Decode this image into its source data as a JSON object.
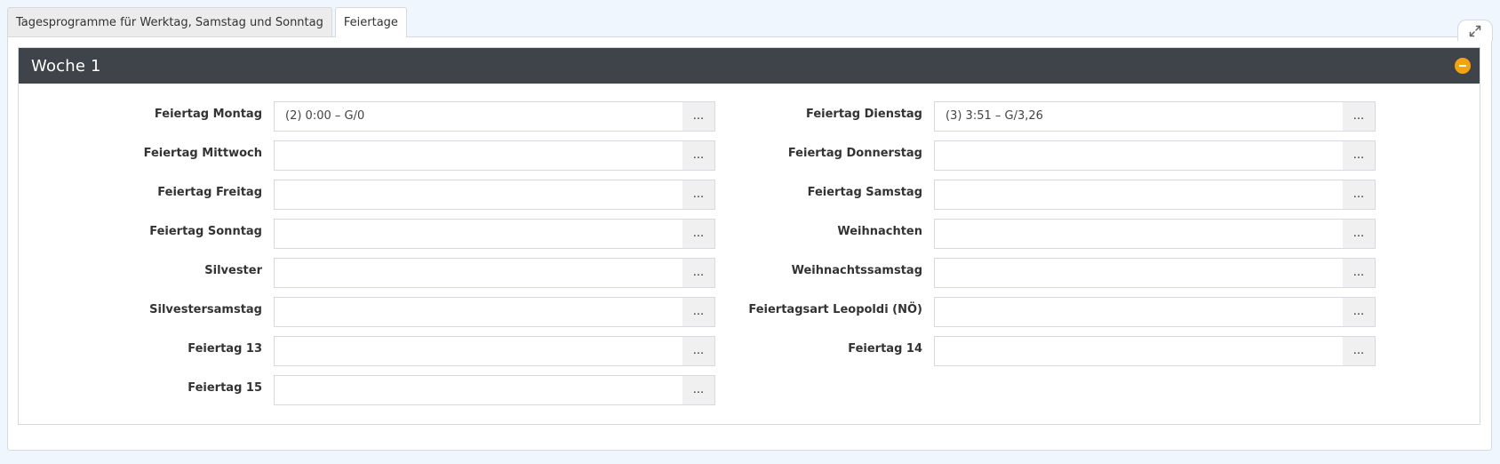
{
  "tabs": [
    {
      "label": "Tagesprogramme für Werktag, Samstag und Sonntag",
      "active": false
    },
    {
      "label": "Feiertage",
      "active": true
    }
  ],
  "section": {
    "title": "Woche 1"
  },
  "picker_label": "...",
  "left_fields": [
    {
      "label": "Feiertag Montag",
      "value": "(2) 0:00 – G/0"
    },
    {
      "label": "Feiertag Mittwoch",
      "value": ""
    },
    {
      "label": "Feiertag Freitag",
      "value": ""
    },
    {
      "label": "Feiertag Sonntag",
      "value": ""
    },
    {
      "label": "Silvester",
      "value": ""
    },
    {
      "label": "Silvestersamstag",
      "value": ""
    },
    {
      "label": "Feiertag 13",
      "value": ""
    },
    {
      "label": "Feiertag 15",
      "value": ""
    }
  ],
  "right_fields": [
    {
      "label": "Feiertag Dienstag",
      "value": "(3) 3:51 – G/3,26"
    },
    {
      "label": "Feiertag Donnerstag",
      "value": ""
    },
    {
      "label": "Feiertag Samstag",
      "value": ""
    },
    {
      "label": "Weihnachten",
      "value": ""
    },
    {
      "label": "Weihnachtssamstag",
      "value": ""
    },
    {
      "label": "Feiertagsart Leopoldi (NÖ)",
      "value": ""
    },
    {
      "label": "Feiertag 14",
      "value": ""
    }
  ],
  "icons": {
    "expand": "expand-arrows-icon",
    "collapse": "collapse-minus-icon"
  },
  "colors": {
    "header_bg": "#3e444a",
    "collapse_accent": "#f2a40f",
    "page_bg": "#f0f6fd"
  }
}
